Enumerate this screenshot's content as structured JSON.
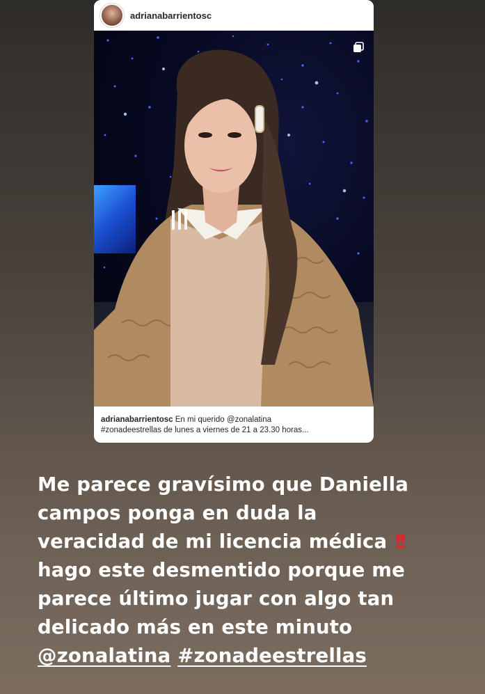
{
  "post": {
    "username": "adrianabarrientosc",
    "caption_user": "adrianabarrientosc",
    "caption_text": "En mi querido @zonalatina",
    "caption_line2": "#zonadeestrellas de lunes a viernes de 21 a 23.30 horas..."
  },
  "icons": {
    "avatar": "profile-avatar",
    "video_state": "pause-icon",
    "carousel": "multiple-posts-icon"
  },
  "story": {
    "line1": "Me parece gravísimo que Daniella",
    "line2": "campos ponga en duda la",
    "line3": "veracidad de mi licencia médica",
    "line3_emoji": "!!",
    "line4": "hago este desmentido porque me",
    "line5": "parece último jugar con algo tan",
    "line6": "delicado más en este minuto",
    "mention": "@zonalatina",
    "hashtag": "#zonadeestrellas"
  },
  "colors": {
    "text": "#ffffff",
    "emoji_red": "#e0262a",
    "card_bg": "#ffffff"
  }
}
